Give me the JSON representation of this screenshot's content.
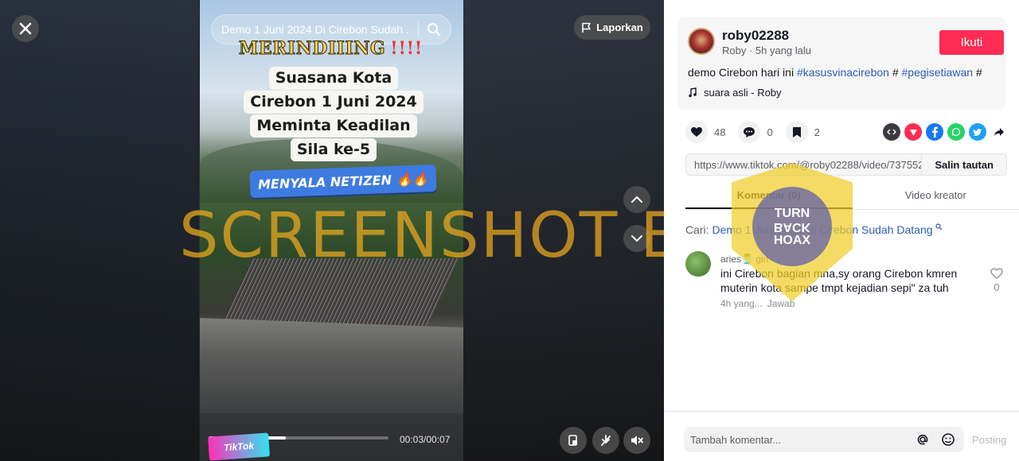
{
  "video": {
    "search_title": "Demo 1 Juni 2024 Di Cirebon Sudah ...",
    "report_label": "Laporkan",
    "overlay_line1": "MERINDIIING",
    "overlay_bang": "!!!!",
    "overlay_lines": [
      "Suasana Kota",
      "Cirebon 1 Juni 2024",
      "Meminta Keadilan",
      "Sila ke-5"
    ],
    "overlay_banner": "MENYALA NETIZEN",
    "overlay_emoji": "🔥🔥",
    "time": "00:03/00:07",
    "progress_fraction": 0.43,
    "logo_text": "TikTok",
    "watermark": "SCREENSHOT BY"
  },
  "post": {
    "username": "roby02288",
    "subline": "Roby · 5h yang lalu",
    "follow_label": "Ikuti",
    "desc_prefix": "demo Cirebon hari ini ",
    "tag1": "#kasusvinacirebon",
    "mid": " # ",
    "tag2": "#pegisetiawan",
    "suffix": " #",
    "music": "suara asli - Roby"
  },
  "stats": {
    "likes": "48",
    "comments": "0",
    "saves": "2"
  },
  "share": {
    "url": "https://www.tiktok.com/@roby02288/video/737552...",
    "copy_label": "Salin tautan"
  },
  "tabs": [
    {
      "label": "Komentar (0)"
    },
    {
      "label": "Video kreator"
    }
  ],
  "search": {
    "prefix": "Cari: ",
    "query": "Demo 1 Juni 2024 Di Cirebon Sudah Datang"
  },
  "comment": {
    "name": "aries🫙 girl",
    "text": "ini Cirebon bagian mna,sy orang Cirebon kmren muterin kota sampe tmpt kejadian sepi\" za tuh",
    "time": "4h yang...",
    "reply": "Jawab",
    "likes": "0"
  },
  "seal": {
    "line1": "TURN",
    "line2": "BACK",
    "line3": "HOAX"
  },
  "composer": {
    "placeholder": "Tambah komentar...",
    "post_label": "Posting"
  },
  "colors": {
    "brand": "#fe2c55",
    "link": "#2b5db9",
    "watermark": "#f0aa1e"
  }
}
